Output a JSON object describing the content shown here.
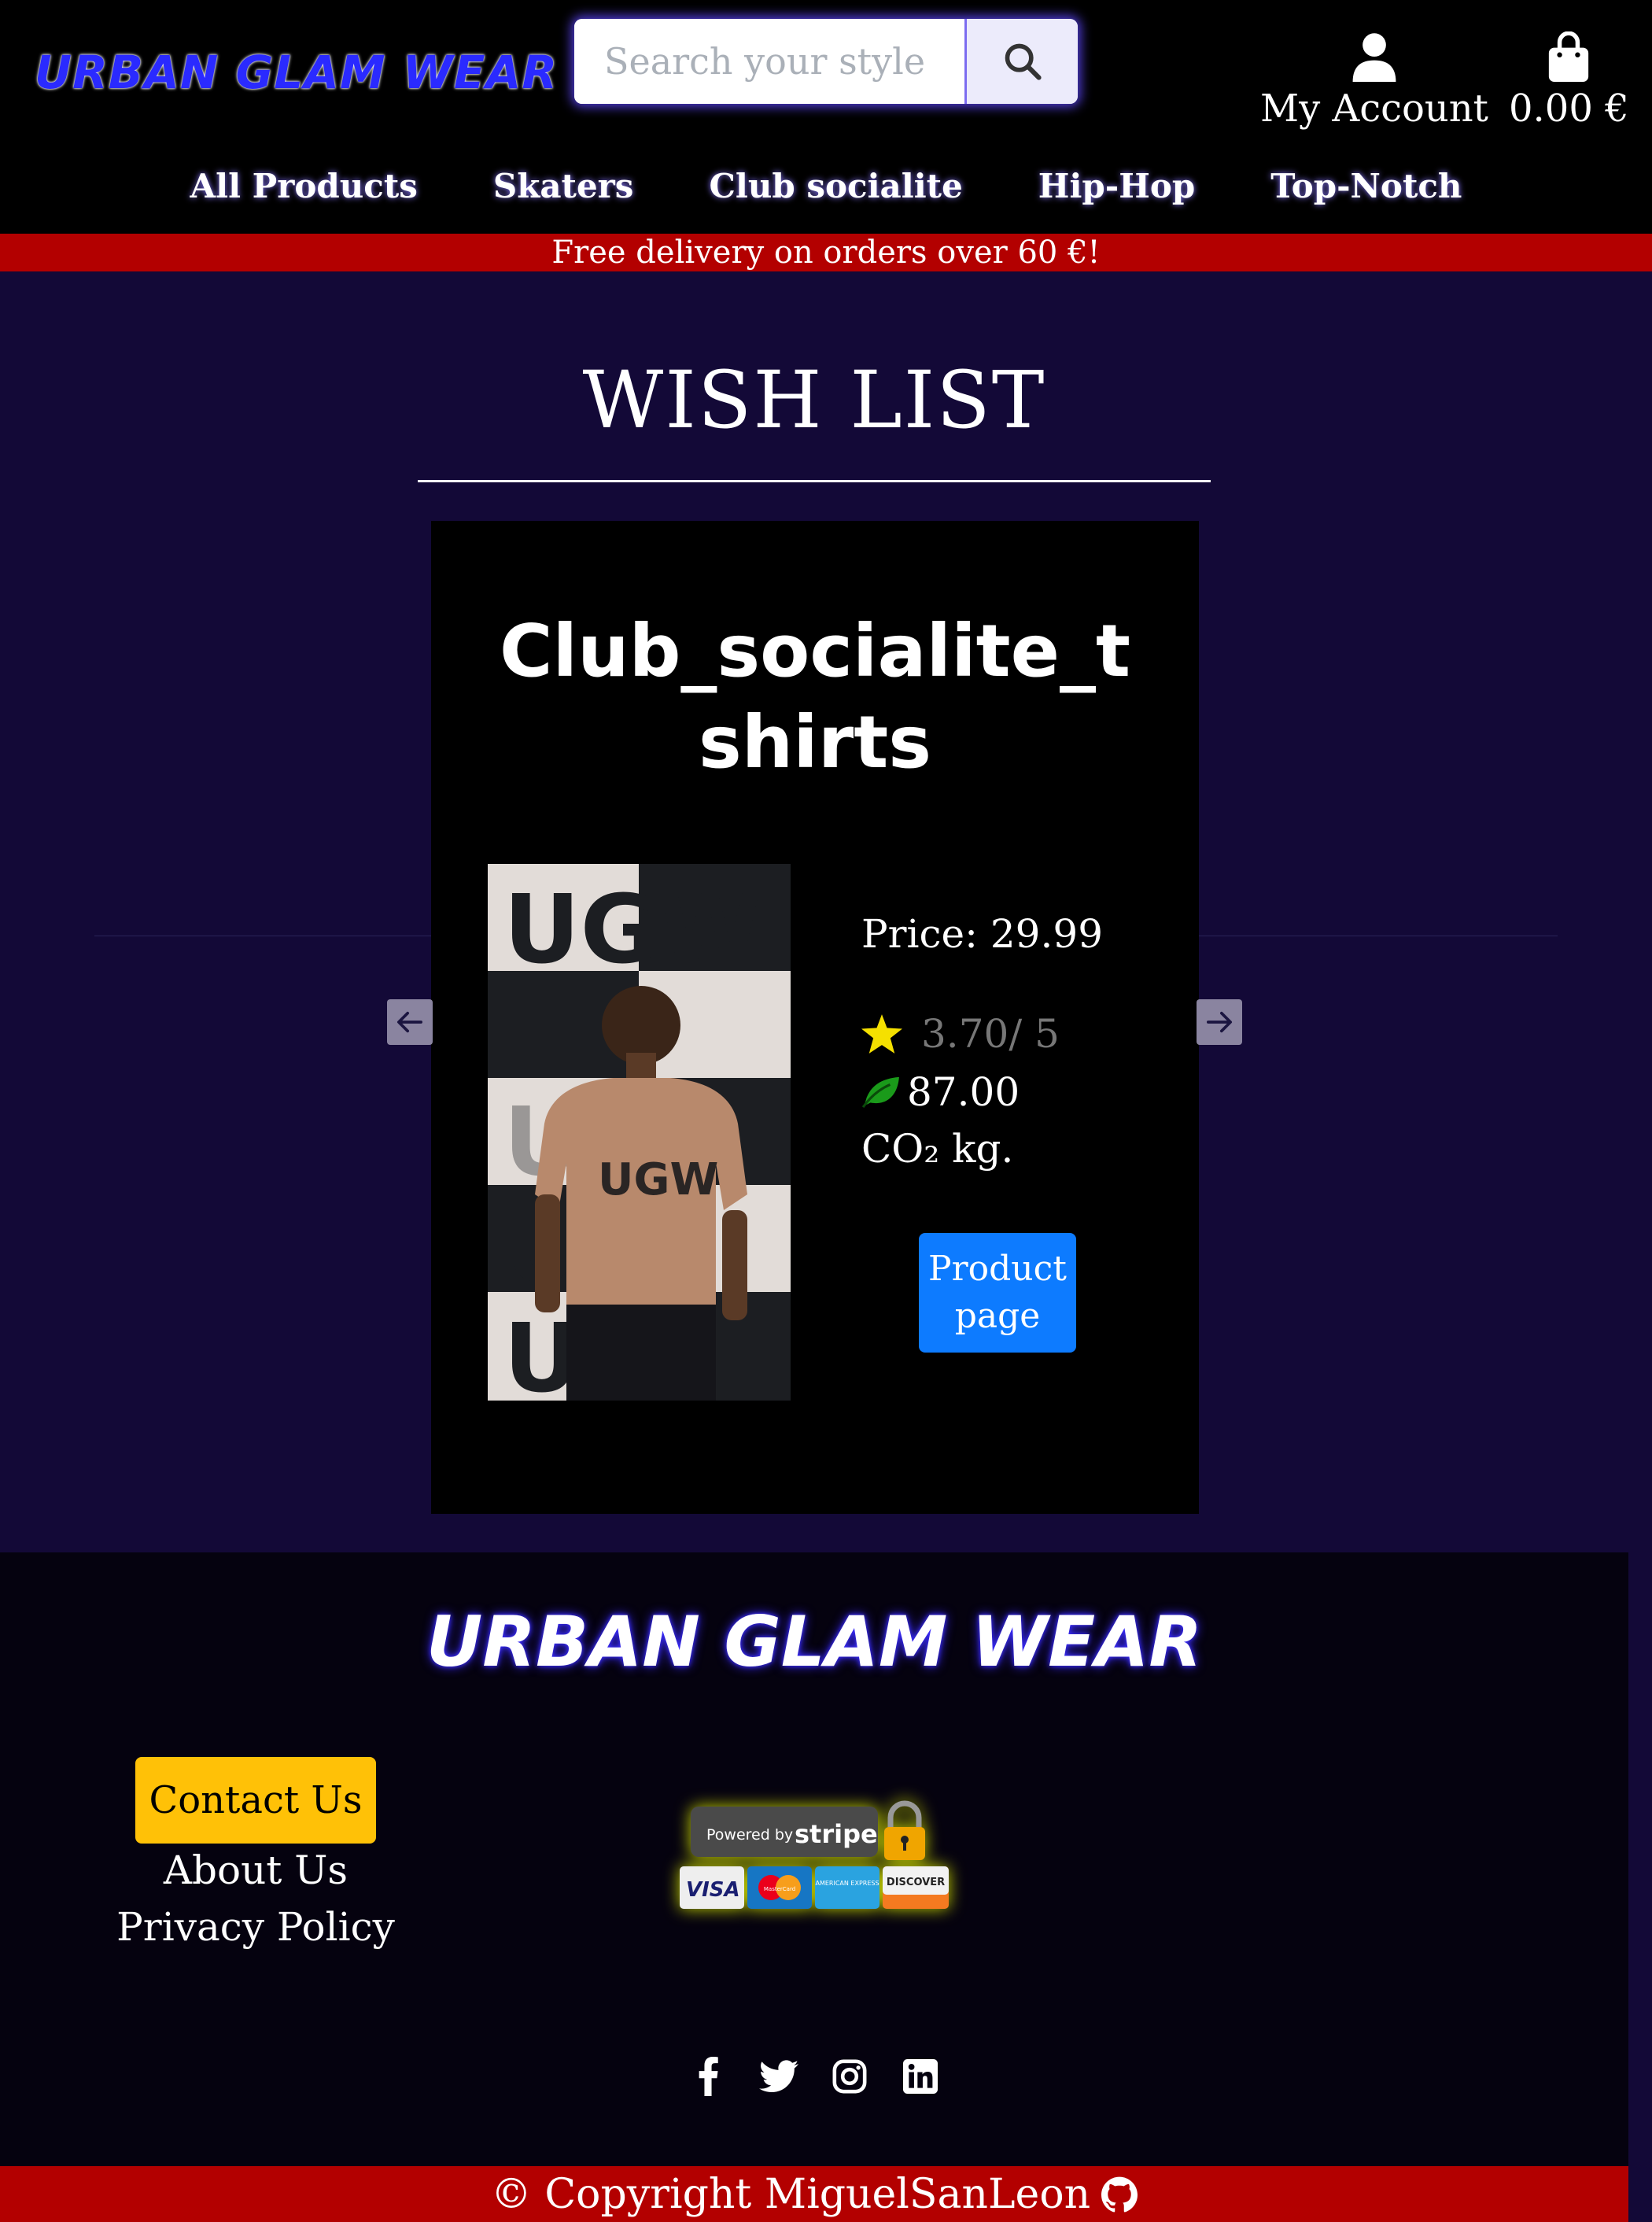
{
  "header": {
    "logo": "URBAN GLAM WEAR",
    "search_placeholder": "Search your style",
    "account_label": "My Account",
    "cart_total": "0.00 €"
  },
  "nav": {
    "items": [
      "All Products",
      "Skaters",
      "Club socialite",
      "Hip-Hop",
      "Top-Notch"
    ]
  },
  "banner": "Free delivery on orders over 60 €!",
  "main": {
    "title": "WISH LIST",
    "product": {
      "name": "Club_socialite_tshirts",
      "image_text": "UGW",
      "price": "Price: 29.99",
      "rating": "3.70/ 5",
      "co2": "87.00 CO₂ kg.",
      "button": "Product page"
    }
  },
  "footer": {
    "logo": "URBAN GLAM WEAR",
    "contact": "Contact Us",
    "about": "About Us",
    "privacy": "Privacy Policy",
    "stripe_powered": "Powered by",
    "stripe_name": "stripe",
    "cards": [
      "VISA",
      "MasterCard",
      "AMERICAN EXPRESS",
      "DISCOVER"
    ],
    "social_icons": [
      "facebook-icon",
      "twitter-icon",
      "instagram-icon",
      "linkedin-icon"
    ],
    "copyright": "© Copyright MiguelSanLeon"
  },
  "colors": {
    "page_bg": "#130937",
    "banner_red": "#b30000",
    "button_blue": "#0d7bff",
    "contact_yellow": "#ffc107"
  }
}
